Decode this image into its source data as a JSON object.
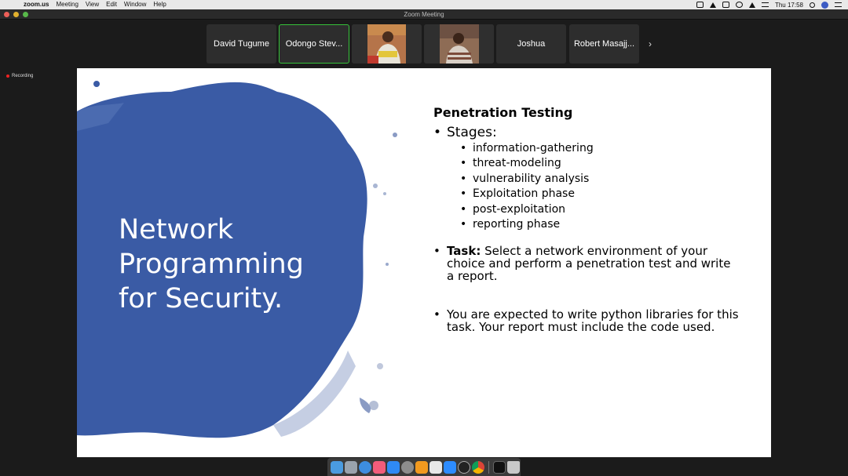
{
  "menubar": {
    "apple_glyph": "",
    "app_name": "zoom.us",
    "menus": [
      "Meeting",
      "View",
      "Edit",
      "Window",
      "Help"
    ],
    "clock": "Thu 17:58"
  },
  "window": {
    "title": "Zoom Meeting"
  },
  "participants": [
    {
      "name": "David Tugume"
    },
    {
      "name": "Odongo Stev..."
    },
    {
      "name": ""
    },
    {
      "name": ""
    },
    {
      "name": "Joshua"
    },
    {
      "name": "Robert Masajj..."
    }
  ],
  "next_arrow": "›",
  "recording_label": "Recording",
  "slide": {
    "title_lines": [
      "Network",
      "Programming",
      "for Security."
    ],
    "heading": "Penetration Testing",
    "stages_label": "Stages:",
    "stages": [
      "information-gathering",
      "threat-modeling",
      "vulnerability analysis",
      "Exploitation phase",
      "post-exploitation",
      "reporting phase"
    ],
    "task_label": "Task:",
    "task_text": " Select a network environment of your choice and perform a penetration test and write a report.",
    "expect_text": "You are expected to write python libraries for this task.  Your report must include the code used.",
    "blob_color": "#3a5ba5"
  },
  "dock_icons": [
    "finder-icon",
    "launchpad-icon",
    "safari-icon",
    "music-icon",
    "app-store-icon",
    "system-preferences-icon",
    "vlc-icon",
    "vim-icon",
    "zoom-icon",
    "clock-icon",
    "chrome-icon",
    "terminal-icon",
    "trash-icon"
  ]
}
